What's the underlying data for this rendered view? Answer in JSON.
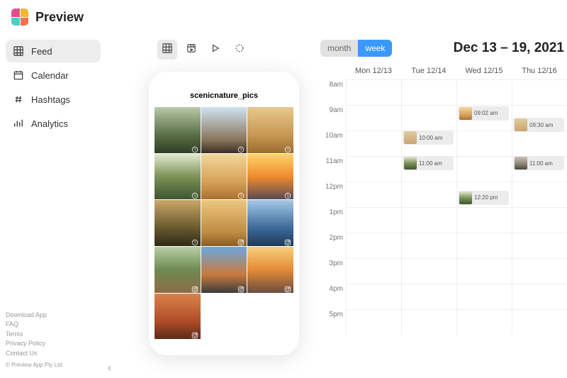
{
  "app": {
    "name": "Preview"
  },
  "nav": [
    {
      "label": "Feed",
      "icon": "grid",
      "active": true
    },
    {
      "label": "Calendar",
      "icon": "calendar",
      "active": false
    },
    {
      "label": "Hashtags",
      "icon": "hash",
      "active": false
    },
    {
      "label": "Analytics",
      "icon": "chart",
      "active": false
    }
  ],
  "footer_links": [
    "Download App",
    "FAQ",
    "Terms",
    "Privacy Policy",
    "Contact Us"
  ],
  "copyright": "© Preview App Pty Ltd",
  "toolbar": [
    {
      "name": "grid-view",
      "active": true
    },
    {
      "name": "reels-view",
      "active": false
    },
    {
      "name": "video-view",
      "active": false
    },
    {
      "name": "refresh",
      "active": false
    }
  ],
  "username": "scenicnature_pics",
  "grid_thumbs": [
    {
      "bg": "bg-forest",
      "badge": "clock"
    },
    {
      "bg": "bg-road",
      "badge": "clock"
    },
    {
      "bg": "bg-desert",
      "badge": "clock"
    },
    {
      "bg": "bg-trees",
      "badge": "clock"
    },
    {
      "bg": "bg-dunes",
      "badge": "clock"
    },
    {
      "bg": "bg-sunset",
      "badge": "clock"
    },
    {
      "bg": "bg-tree-sun",
      "badge": "clock"
    },
    {
      "bg": "bg-dunes2",
      "badge": "ig"
    },
    {
      "bg": "bg-ocean",
      "badge": "ig"
    },
    {
      "bg": "bg-path",
      "badge": "ig"
    },
    {
      "bg": "bg-highway",
      "badge": "ig"
    },
    {
      "bg": "bg-sunset2",
      "badge": "ig"
    },
    {
      "bg": "bg-autumn",
      "badge": "ig"
    }
  ],
  "calendar": {
    "views": {
      "month": "month",
      "week": "week",
      "active": "week"
    },
    "title": "Dec 13 – 19, 2021",
    "days": [
      "Mon 12/13",
      "Tue 12/14",
      "Wed 12/15",
      "Thu 12/16"
    ],
    "hours": [
      "8am",
      "9am",
      "10am",
      "11am",
      "12pm",
      "1pm",
      "2pm",
      "3pm",
      "4pm",
      "5pm"
    ],
    "events": [
      {
        "day": 1,
        "hour_index": 2,
        "offset": 0.0,
        "time": "10:00 am",
        "bg": "bg-dunes3"
      },
      {
        "day": 1,
        "hour_index": 3,
        "offset": 0.0,
        "time": "11:00 am",
        "bg": "bg-trees"
      },
      {
        "day": 2,
        "hour_index": 1,
        "offset": 0.05,
        "time": "09:02 am",
        "bg": "bg-dunes"
      },
      {
        "day": 2,
        "hour_index": 4,
        "offset": 0.35,
        "time": "12:20 pm",
        "bg": "bg-trees"
      },
      {
        "day": 3,
        "hour_index": 1,
        "offset": 0.5,
        "time": "09:30 am",
        "bg": "bg-dunes3"
      },
      {
        "day": 3,
        "hour_index": 3,
        "offset": 0.0,
        "time": "11:00 am",
        "bg": "bg-storm"
      }
    ]
  }
}
